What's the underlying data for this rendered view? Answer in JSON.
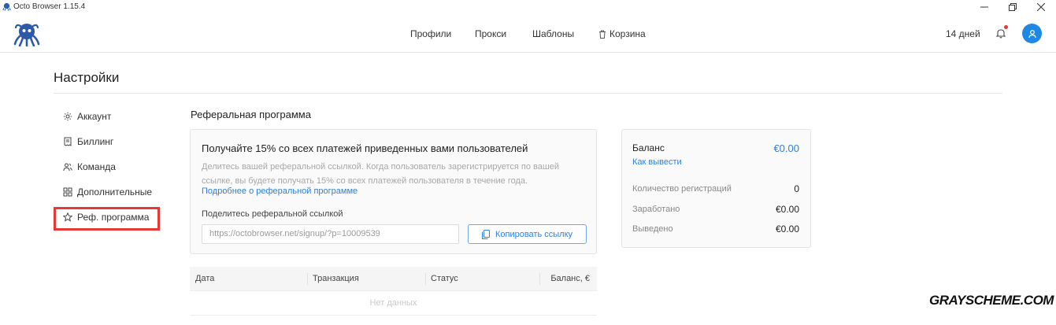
{
  "window": {
    "title": "Octo Browser 1.15.4"
  },
  "nav": {
    "items": [
      "Профили",
      "Прокси",
      "Шаблоны"
    ],
    "trash_label": "Корзина",
    "days_left": "14 дней"
  },
  "page": {
    "title": "Настройки"
  },
  "sidebar": {
    "items": [
      {
        "label": "Аккаунт",
        "icon": "gear-icon"
      },
      {
        "label": "Биллинг",
        "icon": "receipt-icon"
      },
      {
        "label": "Команда",
        "icon": "team-icon"
      },
      {
        "label": "Дополнительные",
        "icon": "grid-icon"
      },
      {
        "label": "Реф. программа",
        "icon": "star-icon"
      }
    ],
    "active_index": 4
  },
  "referral": {
    "section_title": "Реферальная программа",
    "heading": "Получайте 15% со всех платежей приведенных вами пользователей",
    "description": "Делитесь вашей реферальной ссылкой. Когда пользователь зарегистрируется по вашей ссылке, вы будете получать 15% со всех платежей пользователя в течение года.",
    "more_link": "Подробнее о реферальной программе",
    "share_label": "Поделитесь реферальной ссылкой",
    "share_url": "https://octobrowser.net/signup/?p=10009539",
    "copy_button": "Копировать ссылку"
  },
  "balance": {
    "title": "Баланс",
    "value": "€0.00",
    "withdraw_link": "Как вывести",
    "rows": [
      {
        "label": "Количество регистраций",
        "value": "0"
      },
      {
        "label": "Заработано",
        "value": "€0.00"
      },
      {
        "label": "Выведено",
        "value": "€0.00"
      }
    ]
  },
  "table": {
    "columns": [
      "Дата",
      "Транзакция",
      "Статус",
      "Баланс, €"
    ],
    "empty_text": "Нет данных"
  },
  "watermark": "GRAYSCHEME.COM",
  "colors": {
    "accent": "#2f80d8",
    "avatar": "#1e88e5",
    "highlight": "#e53935",
    "notification_dot": "#e53935"
  }
}
